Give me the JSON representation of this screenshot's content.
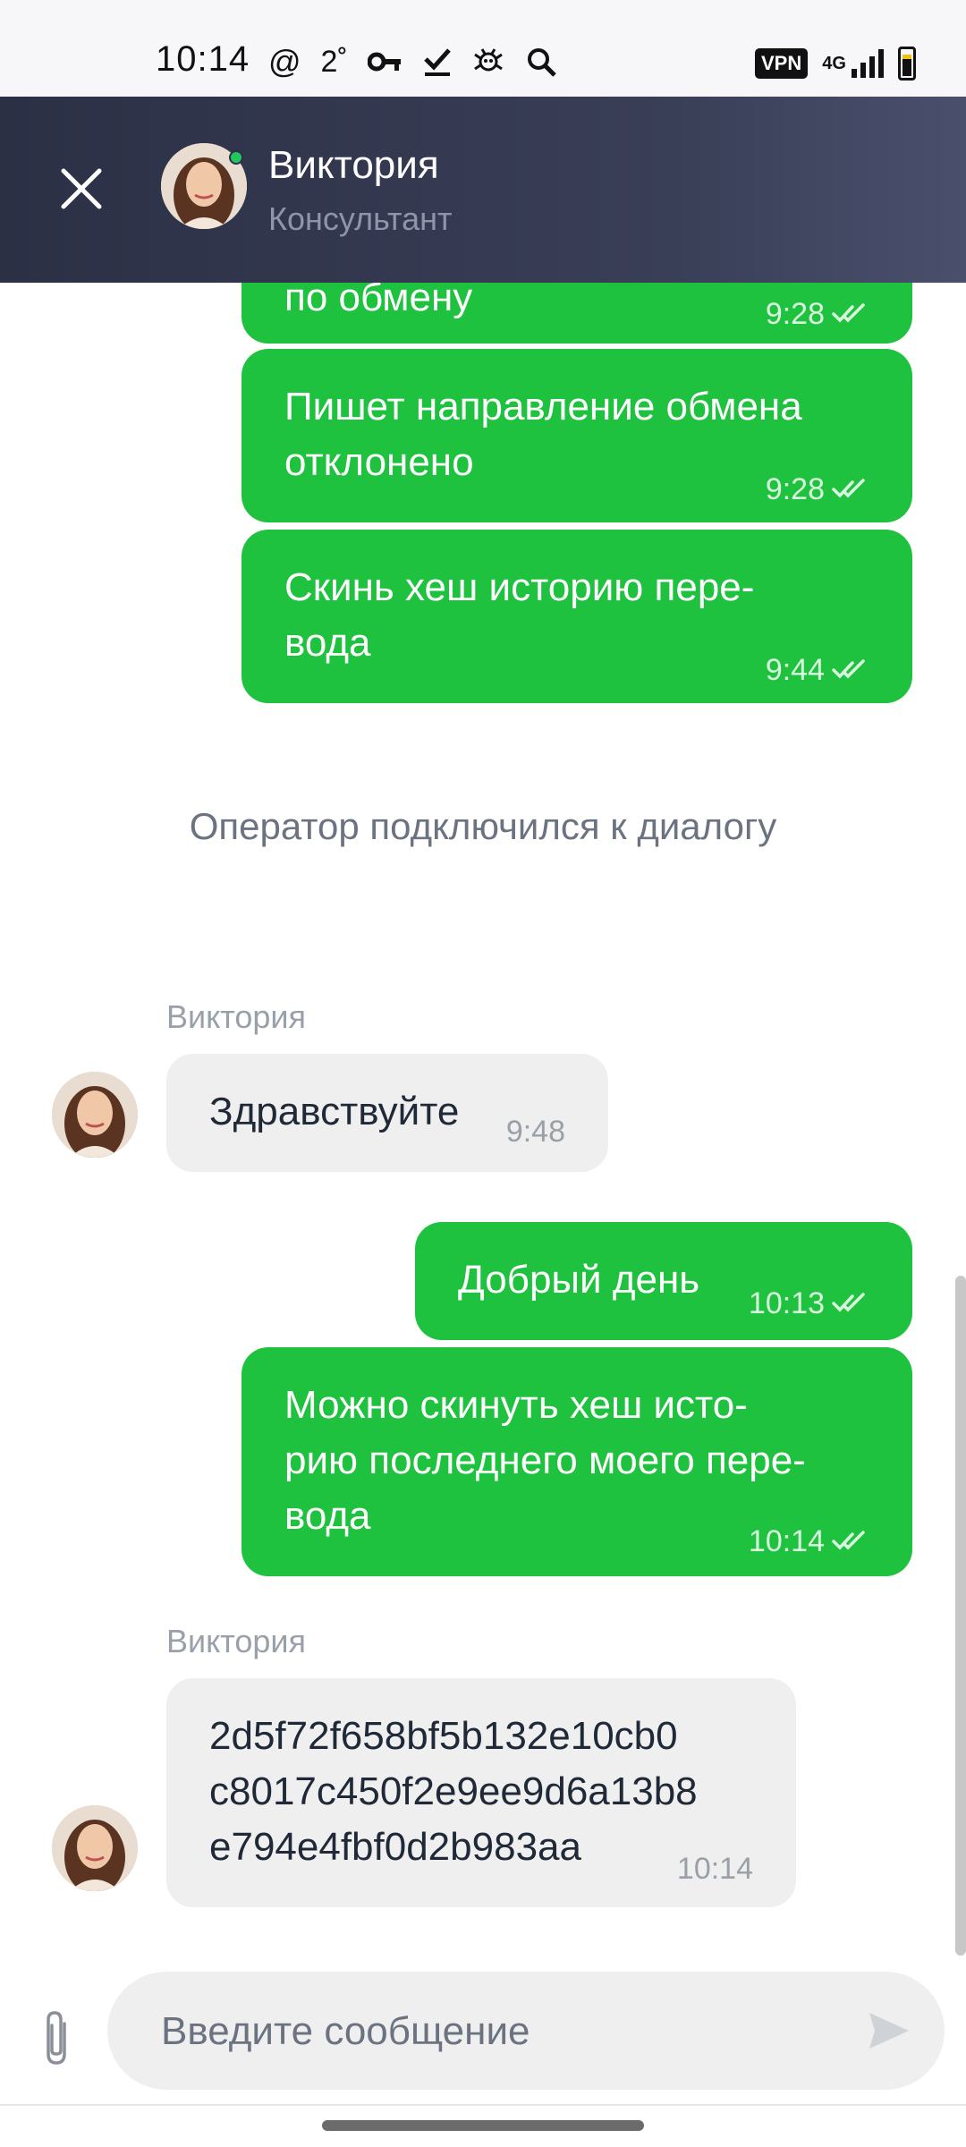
{
  "status_bar": {
    "time": "10:14",
    "icons": [
      "at-icon",
      "temperature-icon",
      "key-icon",
      "check-icon",
      "bug-icon",
      "search-icon"
    ],
    "at": "@",
    "temp": "2˚",
    "vpn": "VPN",
    "network": "4G"
  },
  "header": {
    "name": "Виктория",
    "role": "Консультант"
  },
  "messages": [
    {
      "text": "по обмену",
      "time": "9:28",
      "dir": "out"
    },
    {
      "line1": "Пишет направление обмена",
      "line2": "отклонено",
      "time": "9:28",
      "dir": "out"
    },
    {
      "line1": "Скинь хеш историю пере-",
      "line2": "вода",
      "time": "9:44",
      "dir": "out"
    },
    {
      "system": "Оператор подключился к диалогу"
    },
    {
      "sender": "Виктория",
      "text": "Здравствуйте",
      "time": "9:48",
      "dir": "in"
    },
    {
      "text": "Добрый день",
      "time": "10:13",
      "dir": "out"
    },
    {
      "line1": "Можно скинуть хеш исто-",
      "line2": "рию последнего моего пере-",
      "line3": "вода",
      "time": "10:14",
      "dir": "out"
    },
    {
      "sender": "Виктория",
      "line1": "2d5f72f658bf5b132e10cb0",
      "line2": "c8017c450f2e9ee9d6a13b8",
      "line3": "e794e4fbf0d2b983aa",
      "time": "10:14",
      "dir": "in"
    }
  ],
  "input": {
    "placeholder": "Введите сообщение"
  },
  "colors": {
    "header_bg": "#2b3045",
    "outgoing_bubble": "#1ec23e",
    "incoming_bubble": "#efefef",
    "online": "#22c55e"
  }
}
